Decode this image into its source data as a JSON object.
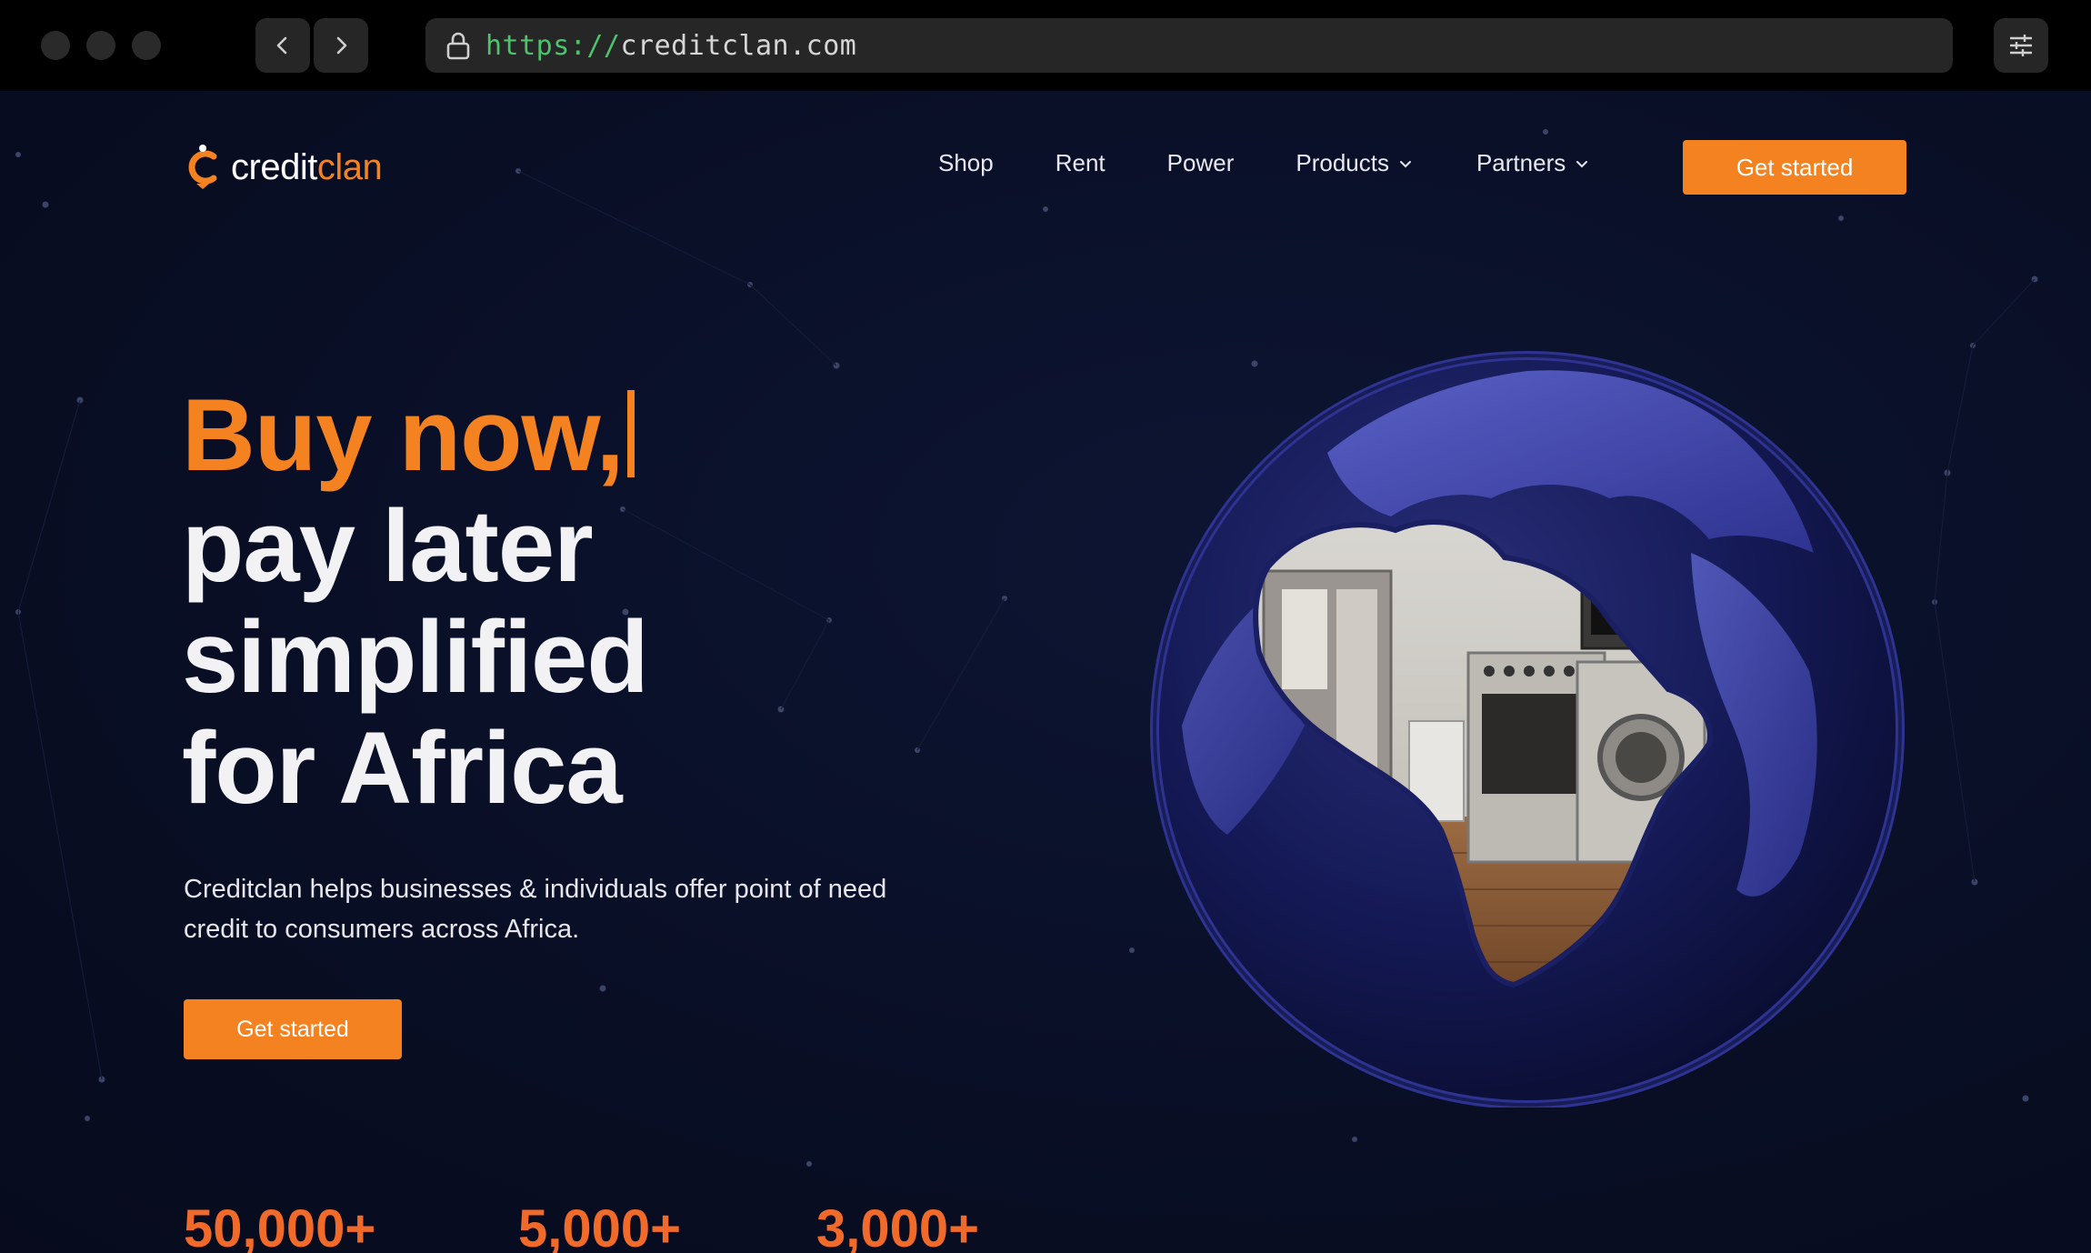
{
  "browser": {
    "url_scheme": "https://",
    "url_host": "creditclan.com"
  },
  "header": {
    "logo_part1": "credit",
    "logo_part2": "clan",
    "nav": [
      {
        "label": "Shop"
      },
      {
        "label": "Rent"
      },
      {
        "label": "Power"
      },
      {
        "label": "Products"
      },
      {
        "label": "Partners"
      }
    ],
    "cta": "Get started"
  },
  "hero": {
    "line1": "Buy now,",
    "line2": "pay later",
    "line3": "simplified",
    "line4": "for Africa",
    "subtitle": "Creditclan helps businesses & individuals offer point of need credit to consumers across Africa.",
    "cta": "Get started"
  },
  "stats": [
    {
      "value": "50,000+"
    },
    {
      "value": "5,000+"
    },
    {
      "value": "3,000+"
    }
  ],
  "colors": {
    "accent": "#f58220",
    "background": "#080d22",
    "globe": "#3a3f9c"
  },
  "icons": [
    "lock-icon",
    "chevron-left-icon",
    "chevron-right-icon",
    "settings-sliders-icon",
    "chevron-down-icon",
    "logo-icon"
  ]
}
